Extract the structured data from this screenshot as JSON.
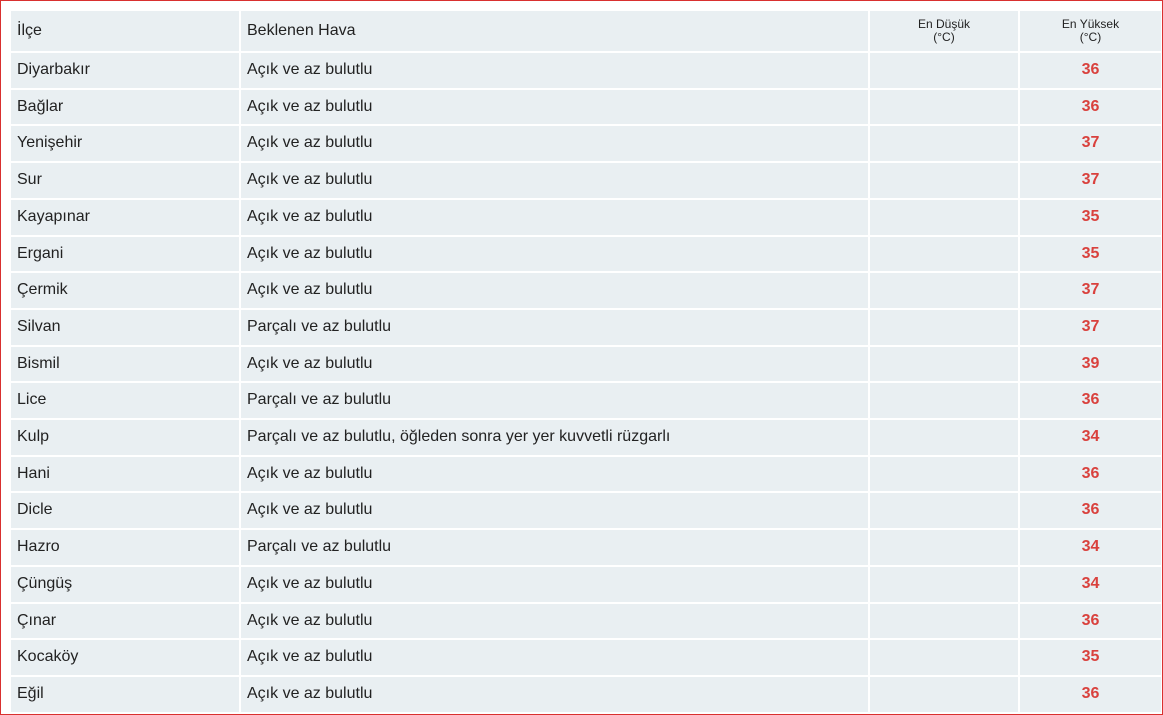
{
  "table": {
    "headers": {
      "district": "İlçe",
      "weather": "Beklenen Hava",
      "min_line1": "En Düşük",
      "min_line2": "(°C)",
      "max_line1": "En Yüksek",
      "max_line2": "(°C)"
    },
    "accent_color": "#d9413d",
    "row_background": "#e9eff2",
    "rows": [
      {
        "district": "Diyarbakır",
        "weather": "Açık ve az bulutlu",
        "min": "",
        "max": "36"
      },
      {
        "district": "Bağlar",
        "weather": "Açık ve az bulutlu",
        "min": "",
        "max": "36"
      },
      {
        "district": "Yenişehir",
        "weather": "Açık ve az bulutlu",
        "min": "",
        "max": "37"
      },
      {
        "district": "Sur",
        "weather": "Açık ve az bulutlu",
        "min": "",
        "max": "37"
      },
      {
        "district": "Kayapınar",
        "weather": "Açık ve az bulutlu",
        "min": "",
        "max": "35"
      },
      {
        "district": "Ergani",
        "weather": "Açık ve az bulutlu",
        "min": "",
        "max": "35"
      },
      {
        "district": "Çermik",
        "weather": "Açık ve az bulutlu",
        "min": "",
        "max": "37"
      },
      {
        "district": "Silvan",
        "weather": "Parçalı ve az bulutlu",
        "min": "",
        "max": "37"
      },
      {
        "district": "Bismil",
        "weather": "Açık ve az bulutlu",
        "min": "",
        "max": "39"
      },
      {
        "district": "Lice",
        "weather": "Parçalı ve az bulutlu",
        "min": "",
        "max": "36"
      },
      {
        "district": "Kulp",
        "weather": "Parçalı ve az bulutlu, öğleden sonra yer yer kuvvetli rüzgarlı",
        "min": "",
        "max": "34"
      },
      {
        "district": "Hani",
        "weather": "Açık ve az bulutlu",
        "min": "",
        "max": "36"
      },
      {
        "district": "Dicle",
        "weather": "Açık ve az bulutlu",
        "min": "",
        "max": "36"
      },
      {
        "district": "Hazro",
        "weather": "Parçalı ve az bulutlu",
        "min": "",
        "max": "34"
      },
      {
        "district": "Çüngüş",
        "weather": "Açık ve az bulutlu",
        "min": "",
        "max": "34"
      },
      {
        "district": "Çınar",
        "weather": "Açık ve az bulutlu",
        "min": "",
        "max": "36"
      },
      {
        "district": "Kocaköy",
        "weather": "Açık ve az bulutlu",
        "min": "",
        "max": "35"
      },
      {
        "district": "Eğil",
        "weather": "Açık ve az bulutlu",
        "min": "",
        "max": "36"
      }
    ]
  }
}
